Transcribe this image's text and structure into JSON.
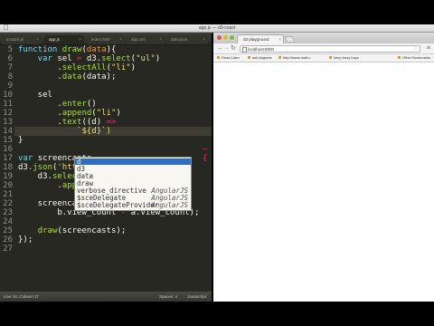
{
  "menubar": {
    "title": "app.js — d3-coast",
    "right": ""
  },
  "editor": {
    "tabs": [
      {
        "label": "scratch.js",
        "active": false
      },
      {
        "label": "app.js",
        "active": true
      },
      {
        "label": "index.html",
        "active": false
      },
      {
        "label": "app.css",
        "active": false
      },
      {
        "label": "data.json",
        "active": false
      }
    ],
    "line_numbers": [
      "5",
      "6",
      "7",
      "8",
      "9",
      "10",
      "11",
      "12",
      "13",
      "14",
      "15",
      "16",
      "17",
      "18",
      "19",
      "20",
      "21",
      "22",
      "23",
      "24",
      "25",
      "26",
      "27"
    ],
    "lines": [
      [
        {
          "t": "function ",
          "c": "kw"
        },
        {
          "t": "draw",
          "c": "fn"
        },
        {
          "t": "(",
          "c": "plain"
        },
        {
          "t": "data",
          "c": "par"
        },
        {
          "t": "){",
          "c": "plain"
        }
      ],
      [
        {
          "t": "    var ",
          "c": "kw"
        },
        {
          "t": "sel ",
          "c": "plain"
        },
        {
          "t": "= ",
          "c": "op"
        },
        {
          "t": "d3.",
          "c": "plain"
        },
        {
          "t": "select",
          "c": "fn"
        },
        {
          "t": "(",
          "c": "plain"
        },
        {
          "t": "\"ul\"",
          "c": "str"
        },
        {
          "t": ")",
          "c": "plain"
        }
      ],
      [
        {
          "t": "        .",
          "c": "plain"
        },
        {
          "t": "selectAll",
          "c": "fn"
        },
        {
          "t": "(",
          "c": "plain"
        },
        {
          "t": "\"li\"",
          "c": "str"
        },
        {
          "t": ")",
          "c": "plain"
        }
      ],
      [
        {
          "t": "        .",
          "c": "plain"
        },
        {
          "t": "data",
          "c": "fn"
        },
        {
          "t": "(data);",
          "c": "plain"
        }
      ],
      [],
      [
        {
          "t": "    sel",
          "c": "plain"
        }
      ],
      [
        {
          "t": "        .",
          "c": "plain"
        },
        {
          "t": "enter",
          "c": "fn"
        },
        {
          "t": "()",
          "c": "plain"
        }
      ],
      [
        {
          "t": "        .",
          "c": "plain"
        },
        {
          "t": "append",
          "c": "fn"
        },
        {
          "t": "(",
          "c": "plain"
        },
        {
          "t": "\"li\"",
          "c": "str"
        },
        {
          "t": ")",
          "c": "plain"
        }
      ],
      [
        {
          "t": "        .",
          "c": "plain"
        },
        {
          "t": "text",
          "c": "fn"
        },
        {
          "t": "((d) ",
          "c": "plain"
        },
        {
          "t": "=>",
          "c": "op"
        }
      ],
      [
        {
          "t": "            `${d}`)",
          "c": "str"
        }
      ],
      [
        {
          "t": "}",
          "c": "plain"
        }
      ],
      [],
      [
        {
          "t": "var ",
          "c": "kw"
        },
        {
          "t": "screencasts",
          "c": "plain"
        }
      ],
      [
        {
          "t": "d3.",
          "c": "plain"
        },
        {
          "t": "json",
          "c": "fn"
        },
        {
          "t": "(",
          "c": "plain"
        },
        {
          "t": "'http:",
          "c": "str"
        }
      ],
      [
        {
          "t": "    d3.",
          "c": "plain"
        },
        {
          "t": "select",
          "c": "fn"
        },
        {
          "t": "(",
          "c": "plain"
        }
      ],
      [
        {
          "t": "        .",
          "c": "plain"
        },
        {
          "t": "append",
          "c": "fn"
        }
      ],
      [],
      [
        {
          "t": "    screencasts ",
          "c": "plain"
        },
        {
          "t": "= ",
          "c": "op"
        },
        {
          "t": "data.",
          "c": "plain"
        },
        {
          "t": "sort",
          "c": "fn"
        },
        {
          "t": "(a,b)",
          "c": "plain"
        }
      ],
      [
        {
          "t": "        b.view_count ",
          "c": "plain"
        },
        {
          "t": "- ",
          "c": "op"
        },
        {
          "t": "a.view_count);",
          "c": "plain"
        }
      ],
      [],
      [
        {
          "t": "    ",
          "c": "plain"
        },
        {
          "t": "draw",
          "c": "fn"
        },
        {
          "t": "(screencasts);",
          "c": "plain"
        }
      ],
      [
        {
          "t": "});",
          "c": "plain"
        }
      ],
      []
    ],
    "overflow_marker": "{",
    "autocomplete": [
      {
        "name": "d",
        "hint": "",
        "selected": true
      },
      {
        "name": "d3",
        "hint": "",
        "selected": false
      },
      {
        "name": "data",
        "hint": "",
        "selected": false
      },
      {
        "name": "draw",
        "hint": "",
        "selected": false
      },
      {
        "name": "verbose_directive",
        "hint": "AngularJS",
        "selected": false
      },
      {
        "name": "$sceDelegate",
        "hint": "AngularJS",
        "selected": false
      },
      {
        "name": "$sceDelegateProvider",
        "hint": "AngularJS",
        "selected": false
      }
    ],
    "status_left": "Line 14, Column 17",
    "status_spaces": "Spaces: 4",
    "status_syntax": "JavaScript"
  },
  "browser": {
    "tab_title": "d3 playground",
    "url": "localhost:8000",
    "bookmarks": [
      {
        "label": "Read Later"
      },
      {
        "label": "ask-kagmas"
      },
      {
        "label": "http://www.matt.c"
      },
      {
        "label": "keep busy boys"
      }
    ],
    "other_bookmarks": "Other Bookmarks"
  }
}
